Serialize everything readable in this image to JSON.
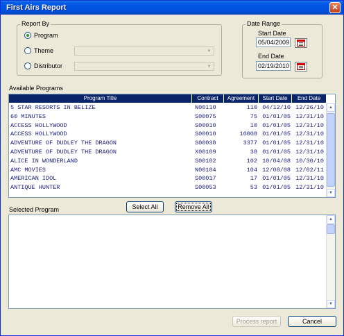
{
  "window": {
    "title": "First Airs Report"
  },
  "report_by": {
    "legend": "Report By",
    "options": [
      {
        "label": "Program",
        "selected": true
      },
      {
        "label": "Theme",
        "selected": false
      },
      {
        "label": "Distributor",
        "selected": false
      }
    ]
  },
  "date_range": {
    "legend": "Date Range",
    "start_label": "Start Date",
    "start_value": "05/04/2009",
    "end_label": "End Date",
    "end_value": "02/19/2010"
  },
  "available": {
    "label": "Available Programs",
    "columns": [
      "Program Title",
      "Contract",
      "Agreement",
      "Start Date",
      "End Date"
    ],
    "rows": [
      [
        "5 STAR RESORTS IN BELIZE",
        "N00110",
        "110",
        "04/12/10",
        "12/26/10"
      ],
      [
        "60 MINUTES",
        "S00075",
        "75",
        "01/01/05",
        "12/31/10"
      ],
      [
        "ACCESS HOLLYWOOD",
        "S00010",
        "10",
        "01/01/05",
        "12/31/10"
      ],
      [
        "ACCESS HOLLYWOOD",
        "S00010",
        "10008",
        "01/01/05",
        "12/31/10"
      ],
      [
        "ADVENTURE OF DUDLEY THE DRAGON",
        "S00038",
        "3377",
        "01/01/05",
        "12/31/10"
      ],
      [
        "ADVENTURE OF DUDLEY THE DRAGON",
        "X00109",
        "38",
        "01/01/05",
        "12/31/10"
      ],
      [
        "ALICE IN WONDERLAND",
        "S00102",
        "102",
        "10/04/08",
        "10/30/10"
      ],
      [
        "AMC MOVIES",
        "N00104",
        "104",
        "12/08/08",
        "12/02/11"
      ],
      [
        "AMERICAN IDOL",
        "S00017",
        "17",
        "01/01/05",
        "12/31/10"
      ],
      [
        "ANTIQUE HUNTER",
        "S00053",
        "53",
        "01/01/05",
        "12/31/10"
      ]
    ]
  },
  "buttons": {
    "select_all": "Select All",
    "remove_all": "Remove All",
    "process_report": "Process report",
    "cancel": "Cancel"
  },
  "selected": {
    "label": "Selected Program"
  }
}
